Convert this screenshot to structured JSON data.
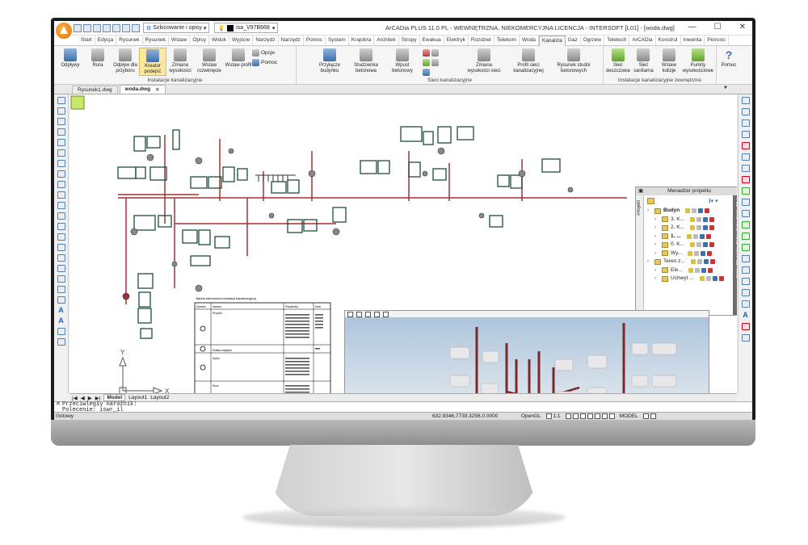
{
  "titlebar": {
    "workspace": "Szkicowanie i opisy",
    "layer": "isa_V97B668",
    "title": "ArCADia PLUS 11.0 PL - WEWNĘTRZNA, NIEKOMERCYJNA LICENCJA - INTERSOFT [L01] - [woda.dwg]",
    "minimize": "—",
    "maximize": "☐",
    "close": "✕"
  },
  "menu": {
    "tabs": [
      "Start",
      "Edycja",
      "Rysunek",
      "Rysunek",
      "Wstaw",
      "Opisy",
      "Widok",
      "Wyjście",
      "Narzędz",
      "Narzędz",
      "Pomoc",
      "System",
      "Krajobra",
      "Architek",
      "Stropy",
      "Ewakua",
      "Elektryk",
      "Rozdziel",
      "Telekom",
      "Woda",
      "Kanaliza",
      "Gaz",
      "Ogrzew",
      "Teletech",
      "ArCADia",
      "Konstrul",
      "Inwenta",
      "Pioruno"
    ],
    "active_index": 20
  },
  "ribbon": {
    "groups": [
      {
        "label": "Instalacje kanalizacyjne",
        "buttons": [
          {
            "label": "Odpływy",
            "icon": "drain-icon"
          },
          {
            "label": "Rura",
            "icon": "pipe-icon"
          },
          {
            "label": "Odpływ dla przyboru",
            "icon": "fixture-drain-icon"
          },
          {
            "label": "Kreator podejść",
            "icon": "wizard-icon",
            "active": true
          },
          {
            "label": "Zmiana wysokości",
            "icon": "height-icon"
          },
          {
            "label": "Wstaw rozwinięcie",
            "icon": "unfold-icon"
          },
          {
            "label": "Wstaw profil",
            "icon": "profile-icon"
          }
        ],
        "small": [
          "Opcje",
          "Pomoc"
        ]
      },
      {
        "label": "Sieci kanalizacyjne",
        "buttons": [
          {
            "label": "Przyłącze budynku",
            "icon": "connection-icon"
          },
          {
            "label": "Studzienka betonowa",
            "icon": "manhole-icon"
          },
          {
            "label": "Wpust betonowy",
            "icon": "inlet-icon"
          },
          {
            "label": "Zmiana wysokości sieci",
            "icon": "net-height-icon"
          },
          {
            "label": "Profil sieci kanalizacyjnej",
            "icon": "net-profile-icon"
          },
          {
            "label": "Rysunek studni betonowych",
            "icon": "well-drawing-icon"
          }
        ]
      },
      {
        "label": "Instalacje kanalizacyjne zewnętrzne",
        "buttons": [
          {
            "label": "Sieć deszczowa",
            "icon": "rain-net-icon"
          },
          {
            "label": "Sieć sanitarna",
            "icon": "sanitary-net-icon"
          },
          {
            "label": "Wstaw kolizje",
            "icon": "collision-icon"
          },
          {
            "label": "Punkty wysokościowe",
            "icon": "elevation-points-icon"
          }
        ]
      },
      {
        "label": "",
        "buttons": [
          {
            "label": "Pomoc",
            "icon": "help-icon"
          }
        ]
      }
    ]
  },
  "doc_tabs": [
    "Rysunek1.dwg",
    "woda.dwg"
  ],
  "doc_tabs_active": 1,
  "project_manager": {
    "title": "Menadżer projektu",
    "side_tab": "Projekt",
    "right_tabs": [
      "Pod",
      "R...1",
      "R...2",
      "R...3",
      "R...4",
      "3D",
      "A...1"
    ],
    "tree": [
      {
        "label": "Budyn",
        "indent": 0,
        "bold": true
      },
      {
        "label": "3. K...",
        "indent": 1
      },
      {
        "label": "2. K...",
        "indent": 1
      },
      {
        "label": "1. ...",
        "indent": 1,
        "bold": true
      },
      {
        "label": "0. K...",
        "indent": 1
      },
      {
        "label": "Wy...",
        "indent": 1
      },
      {
        "label": "Teren z...",
        "indent": 0
      },
      {
        "label": "Ele...",
        "indent": 1
      },
      {
        "label": "Uchwyt ...",
        "indent": 1
      }
    ]
  },
  "legend_table": {
    "title": "Tabela elementów instalacji kanalizacyjnej",
    "headers": [
      "Symbol",
      "Nazwa",
      "Parametry",
      "Ilość"
    ],
    "rows": [
      [
        "",
        "Przybór",
        "",
        ""
      ],
      [
        "",
        "Kratka odpływu",
        "",
        ""
      ],
      [
        "",
        "Syfon",
        "",
        ""
      ],
      [
        "",
        "Rura",
        "",
        ""
      ]
    ]
  },
  "sheet_tabs": [
    "Model",
    "Layout1",
    "Layout2"
  ],
  "sheet_active": 0,
  "command": {
    "line1": "Przeciwległy narożnik:",
    "line2": "Polecenie: iswr_il"
  },
  "status": {
    "ready": "Gotowy",
    "coords": "632.9346,7739.3256,0.0000",
    "renderer": "OpenGL",
    "scale": "1:1",
    "space": "MODEL"
  },
  "colors": {
    "accent": "#3e6fa8",
    "pipe": "#a03232",
    "fixture": "#1c4d3a"
  }
}
